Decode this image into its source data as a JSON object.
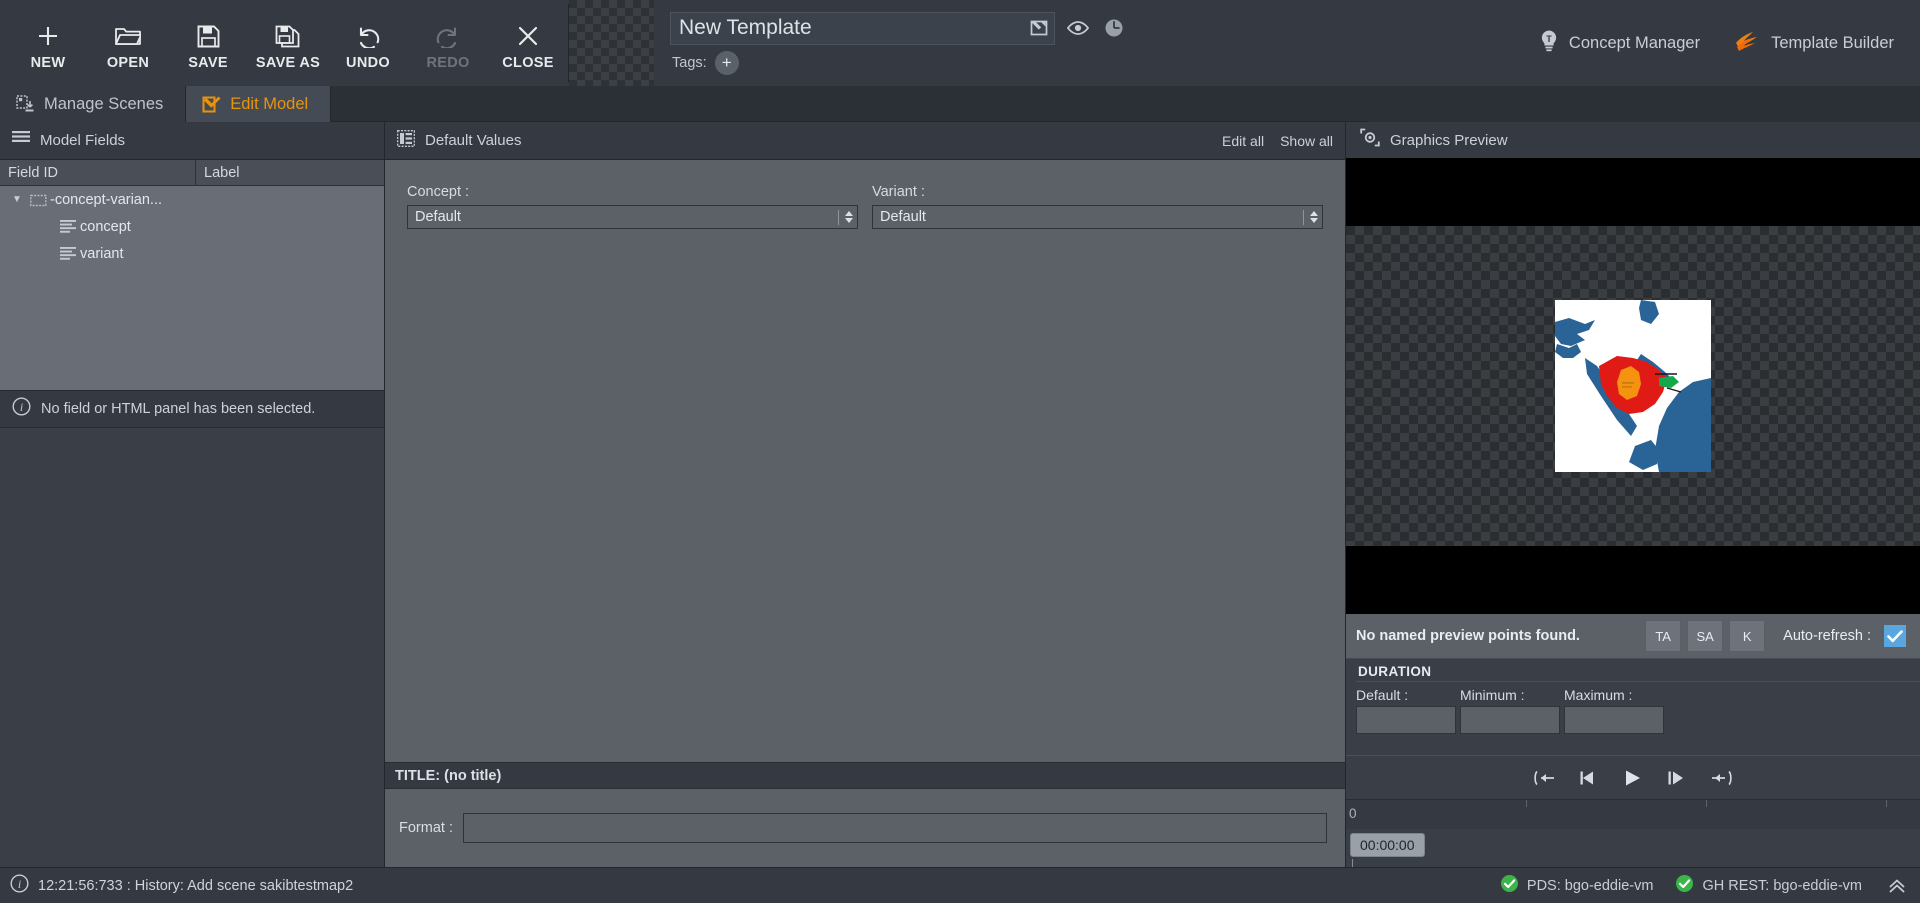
{
  "toolbar": {
    "items": [
      {
        "label": "NEW",
        "icon": "plus-icon",
        "disabled": false
      },
      {
        "label": "OPEN",
        "icon": "folder-icon",
        "disabled": false
      },
      {
        "label": "SAVE",
        "icon": "floppy-icon",
        "disabled": false
      },
      {
        "label": "SAVE AS",
        "icon": "floppy-copy-icon",
        "disabled": false
      },
      {
        "label": "UNDO",
        "icon": "undo-icon",
        "disabled": false
      },
      {
        "label": "REDO",
        "icon": "redo-icon",
        "disabled": true
      },
      {
        "label": "CLOSE",
        "icon": "close-x-icon",
        "disabled": false
      }
    ]
  },
  "template": {
    "name": "New Template",
    "tags_label": "Tags:",
    "tag_add_glyph": "+",
    "rename_icon": "rename-icon",
    "preview_icon": "eye-icon",
    "duration_icon": "clock-icon"
  },
  "top_right": {
    "concept_manager": "Concept Manager",
    "template_builder": "Template Builder",
    "accent_orange": "#f07d10"
  },
  "tabs": [
    {
      "label": "Manage Scenes",
      "icon": "scenes-icon",
      "active": false
    },
    {
      "label": "Edit Model",
      "icon": "edit-model-icon",
      "active": true
    }
  ],
  "model_fields": {
    "panel_title": "Model Fields",
    "columns": [
      "Field ID",
      "Label"
    ],
    "rows": [
      {
        "field_id": "-concept-varian...",
        "label": "",
        "type": "group",
        "expanded": true
      },
      {
        "field_id": "concept",
        "label": "",
        "type": "field",
        "expanded": false
      },
      {
        "field_id": "variant",
        "label": "",
        "type": "field",
        "expanded": false
      }
    ],
    "info_message": "No field or HTML panel has been selected."
  },
  "default_values": {
    "panel_title": "Default Values",
    "edit_all": "Edit all",
    "show_all": "Show all",
    "fields": [
      {
        "label": "Concept :",
        "value": "Default"
      },
      {
        "label": "Variant :",
        "value": "Default"
      }
    ],
    "title_bar": "TITLE: (no title)",
    "format_label": "Format :",
    "format_value": ""
  },
  "graphics_preview": {
    "panel_title": "Graphics Preview",
    "preview_points_message": "No named preview points found.",
    "buttons": [
      "TA",
      "SA",
      "K"
    ],
    "auto_refresh_label": "Auto-refresh :",
    "auto_refresh_checked": true,
    "duration": {
      "section_title": "DURATION",
      "fields": [
        {
          "label": "Default :",
          "value": ""
        },
        {
          "label": "Minimum :",
          "value": ""
        },
        {
          "label": "Maximum :",
          "value": ""
        }
      ]
    },
    "transport": [
      "jump-start-icon",
      "step-back-icon",
      "play-icon",
      "step-forward-icon",
      "jump-end-icon"
    ],
    "timeline": {
      "start_tick": "0",
      "playhead_time": "00:00:00"
    },
    "map_colors": {
      "land": "#ffffff",
      "water": "#2a6496",
      "highlight_primary": "#e01b16",
      "highlight_secondary": "#f59311",
      "highlight_tertiary": "#15a84a"
    }
  },
  "status_bar": {
    "message": "12:21:56:733 : History: Add scene sakibtestmap2",
    "connections": [
      {
        "label": "PDS: bgo-eddie-vm",
        "state": "ok"
      },
      {
        "label": "GH REST: bgo-eddie-vm",
        "state": "ok"
      }
    ],
    "ok_color": "#3cb44a",
    "collapse_icon": "chevron-double-up-icon"
  }
}
